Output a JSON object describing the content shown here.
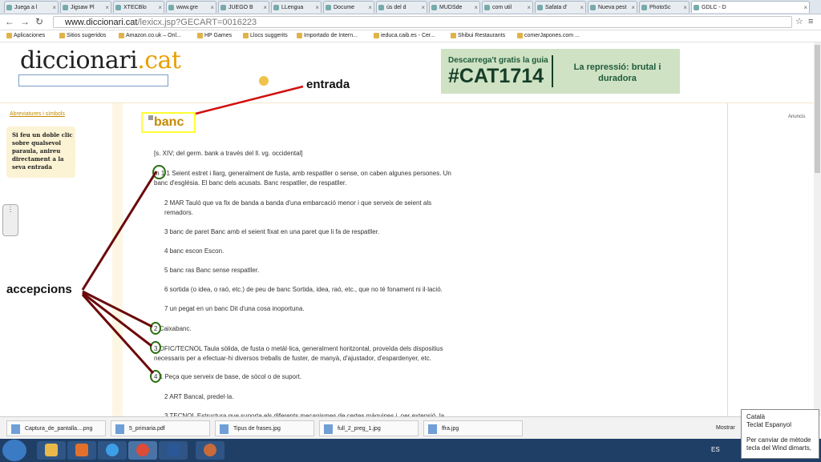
{
  "browser": {
    "tabs": [
      {
        "label": "Juega a l",
        "active": false
      },
      {
        "label": "Jigsaw Pl",
        "active": false
      },
      {
        "label": "XTECBlo",
        "active": false
      },
      {
        "label": "www.gre",
        "active": false
      },
      {
        "label": "JUEGO B",
        "active": false
      },
      {
        "label": "LLengua",
        "active": false
      },
      {
        "label": "Docume",
        "active": false
      },
      {
        "label": "ús del d",
        "active": false
      },
      {
        "label": "MUDSde",
        "active": false
      },
      {
        "label": "com util",
        "active": false
      },
      {
        "label": "Safata d'",
        "active": false
      },
      {
        "label": "Nueva pest",
        "active": false
      },
      {
        "label": "PhotoSc",
        "active": false
      },
      {
        "label": "GDLC - D",
        "active": true
      }
    ],
    "url_host": "www.diccionari.cat",
    "url_path": "/lexicx.jsp?GECART=0016223",
    "bookmarks": [
      "Aplicaciones",
      "Sitios sugeridos",
      "Amazon.co.uk – Onl...",
      "HP Games",
      "Llocs suggerits",
      "Importado de Intern...",
      "ieduca.caib.es - Cer...",
      "Shibui Restaurants",
      "comerJapones.com ..."
    ]
  },
  "site": {
    "logo_main": "diccionari",
    "logo_dot": ".cat",
    "banner_line1": "Descarrega't gratis la guia",
    "banner_line2": "#CAT1714",
    "banner_line3": "La repressió: brutal i duradora",
    "abbrev_link": "Abreviatures i símbols",
    "tip_text": "Si feu un doble clic sobre qualsevol paraula, anireu directament a la seva entrada",
    "ad_label": "Anuncis"
  },
  "entry": {
    "headword": "banc",
    "etymology": "[s. XIV; del germ. bank a través del ll. vg. occidental]",
    "lines": [
      "m 1 1 Seient estret i llarg, generalment de fusta, amb respatller o sense, on caben algunes persones. Un",
      "banc d'església. El banc dels acusats. Banc respatller, de respatller.",
      "2 MAR Tauló que va fix de banda a banda d'una embarcació menor i que serveix de seient als",
      "remadors.",
      "3 banc de paret Banc amb el seient fixat en una paret que li fa de respatller.",
      "4 banc escon Escon.",
      "5 banc ras Banc sense respatller.",
      "6 sortida (o idea, o raó, etc.) de peu de banc Sortida, idea, raó, etc., que no té fonament ni il·lació.",
      "7 un pegat en un banc Dit d'una cosa inoportuna.",
      "2 Caixabanc.",
      "3 OFIC/TECNOL Taula sòlida, de fusta o metàl·lica, generalment horitzontal, proveïda dels dispositius",
      "necessaris per a efectuar-hi diversos treballs de fuster, de manyà, d'ajustador, d'espardenyer, etc.",
      "4 1 Peça que serveix de base, de sòcol o de suport.",
      "2 ART Bancal, predel·la.",
      "3 TECNOL Estructura que suporta els diferents mecanismes de certes màquines i, per extensió, la"
    ]
  },
  "annotations": {
    "entrada": "entrada",
    "accepcions": "accepcions"
  },
  "downloads": [
    "Captura_de_pantalla....png",
    "5_primaria.pdf",
    "Tipus de frases.jpg",
    "full_2_preg_1.jpg",
    "ffra.jpg"
  ],
  "show_all": "Mostrar",
  "taskbar": {
    "lang": "ES"
  },
  "ime_popup": {
    "line1": "Català",
    "line2": "Teclat Espanyol",
    "line3": "Per canviar de mètode",
    "line4": "tecla del Wind dimarts,"
  }
}
